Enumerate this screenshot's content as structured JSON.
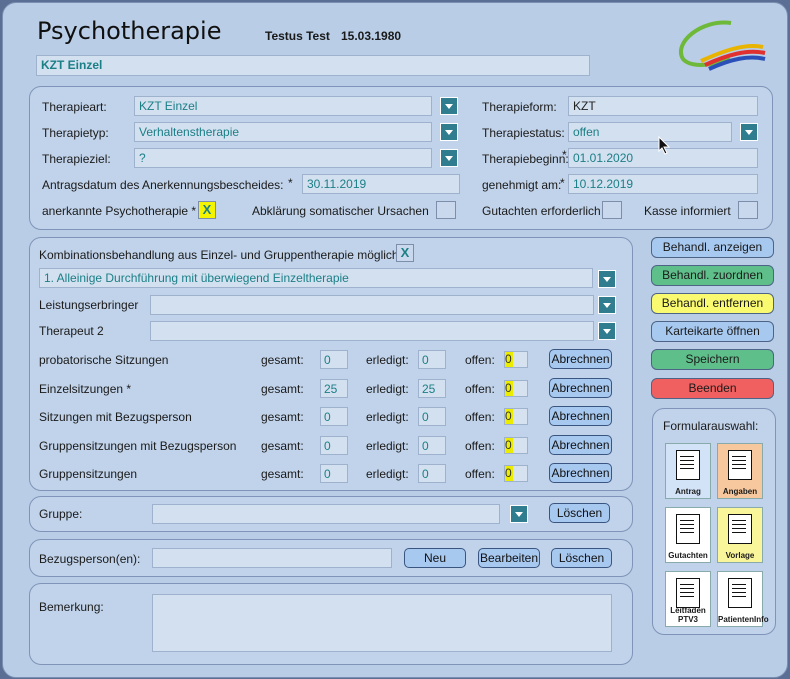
{
  "header": {
    "title": "Psychotherapie",
    "patient_name": "Testus Test",
    "birth_date": "15.03.1980",
    "therapy_label": "KZT Einzel"
  },
  "details": {
    "therapieart_label": "Therapieart:",
    "therapieart_value": "KZT Einzel",
    "therapietyp_label": "Therapietyp:",
    "therapietyp_value": "Verhaltenstherapie",
    "therapieziel_label": "Therapieziel:",
    "therapieziel_value": "?",
    "antragsdatum_label": "Antragsdatum des Anerkennungsbescheides:",
    "antragsdatum_star": "*",
    "antragsdatum_value": "30.11.2019",
    "anerkannt_label": "anerkannte Psychotherapie *",
    "anerkannt_value": "X",
    "abklaerung_label": "Abklärung somatischer Ursachen",
    "therapieform_label": "Therapieform:",
    "therapieform_value": "KZT",
    "therapiestatus_label": "Therapiestatus:",
    "therapiestatus_value": "offen",
    "therapiebeginn_label": "Therapiebeginn:",
    "therapiebeginn_star": "*",
    "therapiebeginn_value": "01.01.2020",
    "genehmigt_label": "genehmigt am:",
    "genehmigt_star": "*",
    "genehmigt_value": "10.12.2019",
    "gutachten_label": "Gutachten erforderlich",
    "kasse_label": "Kasse informiert"
  },
  "kombi": {
    "label": "Kombinationsbehandlung aus Einzel- und Gruppentherapie möglich",
    "check": "X",
    "option": "1. Alleinige Durchführung mit überwiegend Einzeltherapie",
    "leistungserbringer_label": "Leistungserbringer",
    "therapeut2_label": "Therapeut 2",
    "gesamt_label": "gesamt:",
    "erledigt_label": "erledigt:",
    "offen_label": "offen:",
    "abrechnen_label": "Abrechnen",
    "rows": [
      {
        "label": "probatorische Sitzungen",
        "gesamt": "0",
        "erledigt": "0",
        "offen": "0"
      },
      {
        "label": "Einzelsitzungen *",
        "gesamt": "25",
        "erledigt": "25",
        "offen": "0"
      },
      {
        "label": "Sitzungen mit Bezugsperson",
        "gesamt": "0",
        "erledigt": "0",
        "offen": "0"
      },
      {
        "label": "Gruppensitzungen mit Bezugsperson",
        "gesamt": "0",
        "erledigt": "0",
        "offen": "0"
      },
      {
        "label": "Gruppensitzungen",
        "gesamt": "0",
        "erledigt": "0",
        "offen": "0"
      }
    ]
  },
  "gruppe": {
    "label": "Gruppe:",
    "loeschen": "Löschen"
  },
  "bezug": {
    "label": "Bezugsperson(en):",
    "neu": "Neu",
    "bearbeiten": "Bearbeiten",
    "loeschen": "Löschen"
  },
  "bemerkung": {
    "label": "Bemerkung:"
  },
  "sidebar": {
    "anzeigen": "Behandl. anzeigen",
    "zuordnen": "Behandl. zuordnen",
    "entfernen": "Behandl. entfernen",
    "karteikarte": "Karteikarte öffnen",
    "speichern": "Speichern",
    "beenden": "Beenden",
    "formular_title": "Formularauswahl:",
    "forms": [
      "Antrag",
      "Angaben",
      "Gutachten",
      "Vorlage",
      "Leitfaden PTV3",
      "PatientenInfo"
    ]
  },
  "colors": {
    "window": "#b9cde6",
    "accent_teal": "#1b7f86",
    "btn_blue": "#a7c8ef",
    "btn_green": "#5fbf8a",
    "btn_yellow": "#fafa70",
    "btn_red": "#f06060"
  }
}
